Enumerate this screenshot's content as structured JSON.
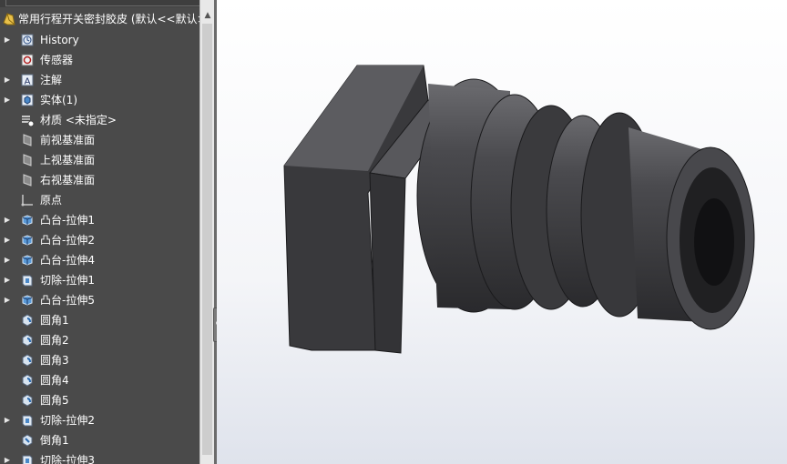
{
  "feature_tree": {
    "root_label": "常用行程开关密封胶皮 (默认<<默认>",
    "items": [
      {
        "label": "History",
        "icon": "history-icon",
        "expandable": true
      },
      {
        "label": "传感器",
        "icon": "sensor-icon",
        "expandable": false
      },
      {
        "label": "注解",
        "icon": "annotation-icon",
        "expandable": true
      },
      {
        "label": "实体(1)",
        "icon": "solid-body-icon",
        "expandable": true
      },
      {
        "label": "材质 <未指定>",
        "icon": "material-icon",
        "expandable": false
      },
      {
        "label": "前视基准面",
        "icon": "plane-icon",
        "expandable": false
      },
      {
        "label": "上视基准面",
        "icon": "plane-icon",
        "expandable": false
      },
      {
        "label": "右视基准面",
        "icon": "plane-icon",
        "expandable": false
      },
      {
        "label": "原点",
        "icon": "origin-icon",
        "expandable": false
      },
      {
        "label": "凸台-拉伸1",
        "icon": "boss-extrude-icon",
        "expandable": true
      },
      {
        "label": "凸台-拉伸2",
        "icon": "boss-extrude-icon",
        "expandable": true
      },
      {
        "label": "凸台-拉伸4",
        "icon": "boss-extrude-icon",
        "expandable": true
      },
      {
        "label": "切除-拉伸1",
        "icon": "cut-extrude-icon",
        "expandable": true
      },
      {
        "label": "凸台-拉伸5",
        "icon": "boss-extrude-icon",
        "expandable": true
      },
      {
        "label": "圆角1",
        "icon": "fillet-icon",
        "expandable": false
      },
      {
        "label": "圆角2",
        "icon": "fillet-icon",
        "expandable": false
      },
      {
        "label": "圆角3",
        "icon": "fillet-icon",
        "expandable": false
      },
      {
        "label": "圆角4",
        "icon": "fillet-icon",
        "expandable": false
      },
      {
        "label": "圆角5",
        "icon": "fillet-icon",
        "expandable": false
      },
      {
        "label": "切除-拉伸2",
        "icon": "cut-extrude-icon",
        "expandable": true
      },
      {
        "label": "倒角1",
        "icon": "chamfer-icon",
        "expandable": false
      },
      {
        "label": "切除-拉伸3",
        "icon": "cut-extrude-icon",
        "expandable": true
      }
    ]
  },
  "scroll_up_icon": "chevron-up-icon",
  "model_view": {
    "part_icon": "seal-part-model"
  },
  "colors": {
    "panel_bg": "#4a4a4a",
    "text": "#ffffff",
    "model_body": "#3c3c3f"
  }
}
